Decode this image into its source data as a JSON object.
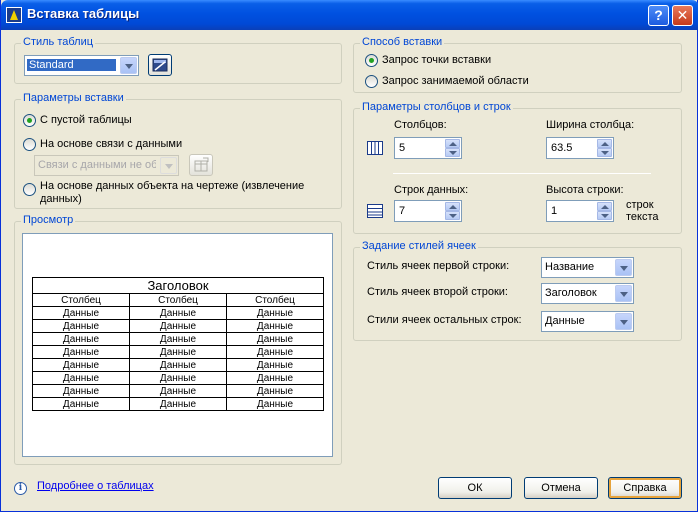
{
  "window": {
    "title": "Вставка таблицы"
  },
  "table_style": {
    "label": "Стиль таблиц",
    "value": "Standard"
  },
  "insert_params": {
    "label": "Параметры вставки",
    "options": [
      {
        "label": "С пустой таблицы",
        "selected": true
      },
      {
        "label": "На основе связи с данными",
        "selected": false
      },
      {
        "label": "На основе данных объекта на чертеже (извлечение данных)",
        "selected": false
      }
    ],
    "link_combo_value": "Связи с данными не обн"
  },
  "preview": {
    "label": "Просмотр",
    "table_title": "Заголовок",
    "headers": [
      "Столбец",
      "Столбец",
      "Столбец"
    ],
    "rows": [
      [
        "Данные",
        "Данные",
        "Данные"
      ],
      [
        "Данные",
        "Данные",
        "Данные"
      ],
      [
        "Данные",
        "Данные",
        "Данные"
      ],
      [
        "Данные",
        "Данные",
        "Данные"
      ],
      [
        "Данные",
        "Данные",
        "Данные"
      ],
      [
        "Данные",
        "Данные",
        "Данные"
      ],
      [
        "Данные",
        "Данные",
        "Данные"
      ],
      [
        "Данные",
        "Данные",
        "Данные"
      ]
    ]
  },
  "insert_method": {
    "label": "Способ вставки",
    "options": [
      {
        "label": "Запрос точки вставки",
        "selected": true
      },
      {
        "label": "Запрос занимаемой области",
        "selected": false
      }
    ]
  },
  "columns_rows": {
    "label": "Параметры столбцов и строк",
    "columns_label": "Столбцов:",
    "columns_value": "5",
    "col_width_label": "Ширина столбца:",
    "col_width_value": "63.5",
    "data_rows_label": "Строк данных:",
    "data_rows_value": "7",
    "row_height_label": "Высота строки:",
    "row_height_value": "1",
    "row_height_unit_line1": "строк",
    "row_height_unit_line2": "текста"
  },
  "cell_styles": {
    "label": "Задание стилей ячеек",
    "first_row_label": "Стиль ячеек первой строки:",
    "first_row_value": "Название",
    "second_row_label": "Стиль ячеек второй строки:",
    "second_row_value": "Заголовок",
    "other_rows_label": "Стили ячеек остальных строк:",
    "other_rows_value": "Данные"
  },
  "footer": {
    "link": "Подробнее о таблицах",
    "ok": "ОК",
    "cancel": "Отмена",
    "help": "Справка"
  }
}
